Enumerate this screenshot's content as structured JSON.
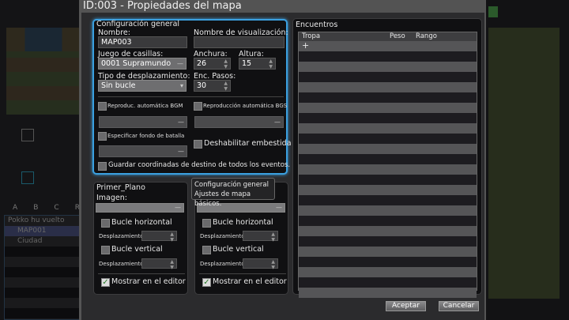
{
  "background": {
    "tree_columns": [
      "A",
      "B",
      "C",
      "R"
    ],
    "tree_items": [
      "Pokko hu vuelto",
      "MAP001",
      "Ciudad"
    ]
  },
  "dialog": {
    "title": "ID:003 - Propiedades del mapa",
    "general": {
      "title": "Configuración general",
      "name_label": "Nombre:",
      "name_value": "MAP003",
      "display_name_label": "Nombre de visualización:",
      "display_name_value": "",
      "tileset_label": "Juego de casillas:",
      "tileset_value": "0001 Supramundo",
      "width_label": "Anchura:",
      "width_value": "26",
      "height_label": "Altura:",
      "height_value": "15",
      "scroll_label": "Tipo de desplazamiento:",
      "scroll_value": "Sin bucle",
      "steps_label": "Enc. Pasos:",
      "steps_value": "30",
      "bgm_label": "Reproduc. automática BGM",
      "bgm_checked": false,
      "bgs_label": "Reproducción automática BGS",
      "bgs_checked": false,
      "battleback_label": "Especificar fondo de batalla",
      "battleback_checked": false,
      "dash_label": "Deshabilitar embestida",
      "dash_checked": false,
      "save_coords_label": "Guardar coordinadas de destino de todos los eventos.",
      "save_coords_checked": false
    },
    "foreground": {
      "title": "Primer_Plano",
      "image_label": "Imagen:",
      "hloop_label": "Bucle horizontal",
      "offset_label": "Desplazamiento:",
      "vloop_label": "Bucle vertical",
      "show_label": "Mostrar en el editor",
      "show_checked": true
    },
    "parallax": {
      "hloop_label": "Bucle horizontal",
      "offset_label": "Desplazamiento:",
      "vloop_label": "Bucle vertical",
      "show_label": "Mostrar en el editor",
      "show_checked": true
    },
    "tooltip": {
      "title": "Configuración general",
      "text": "Ajustes de mapa básicos."
    },
    "encounters": {
      "title": "Encuentros",
      "columns": [
        "Tropa",
        "Peso",
        "Rango"
      ],
      "add_symbol": "+"
    },
    "ok_label": "Aceptar",
    "cancel_label": "Cancelar"
  }
}
